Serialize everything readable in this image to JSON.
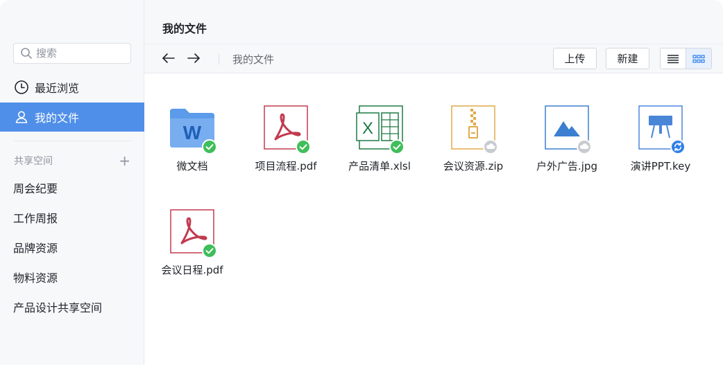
{
  "search": {
    "placeholder": "搜索"
  },
  "nav": [
    {
      "label": "最近浏览",
      "icon": "clock-icon",
      "active": false
    },
    {
      "label": "我的文件",
      "icon": "user-icon",
      "active": true
    }
  ],
  "spaces": {
    "title": "共享空间",
    "add_icon": "plus-icon",
    "items": [
      {
        "label": "周会纪要"
      },
      {
        "label": "工作周报"
      },
      {
        "label": "品牌资源"
      },
      {
        "label": "物料资源"
      },
      {
        "label": "产品设计共享空间"
      }
    ]
  },
  "header": {
    "title": "我的文件"
  },
  "toolbar": {
    "back_icon": "arrow-left-icon",
    "forward_icon": "arrow-right-icon",
    "breadcrumb": "我的文件",
    "upload_label": "上传",
    "new_label": "新建",
    "view_list_icon": "list-view-icon",
    "view_grid_icon": "grid-view-icon",
    "active_view": "grid"
  },
  "files": [
    {
      "name": "微文档",
      "type": "folder-doc",
      "status": "synced"
    },
    {
      "name": "项目流程.pdf",
      "type": "pdf",
      "status": "synced"
    },
    {
      "name": "产品清单.xlsl",
      "type": "excel",
      "status": "synced"
    },
    {
      "name": "会议资源.zip",
      "type": "zip",
      "status": "cloud"
    },
    {
      "name": "户外广告.jpg",
      "type": "image",
      "status": "cloud"
    },
    {
      "name": "演讲PPT.key",
      "type": "keynote",
      "status": "syncing"
    },
    {
      "name": "会议日程.pdf",
      "type": "pdf",
      "status": "synced"
    }
  ],
  "colors": {
    "accent": "#4f8fe9",
    "synced": "#3fbe5a",
    "cloud": "#c8cbd0",
    "syncing": "#2f7fe8",
    "pdf": "#c23a4f",
    "excel": "#1d7a45",
    "zip": "#e0a94a",
    "image": "#3b7fd0",
    "keynote": "#4a86d8",
    "folder": "#5b9bea"
  }
}
